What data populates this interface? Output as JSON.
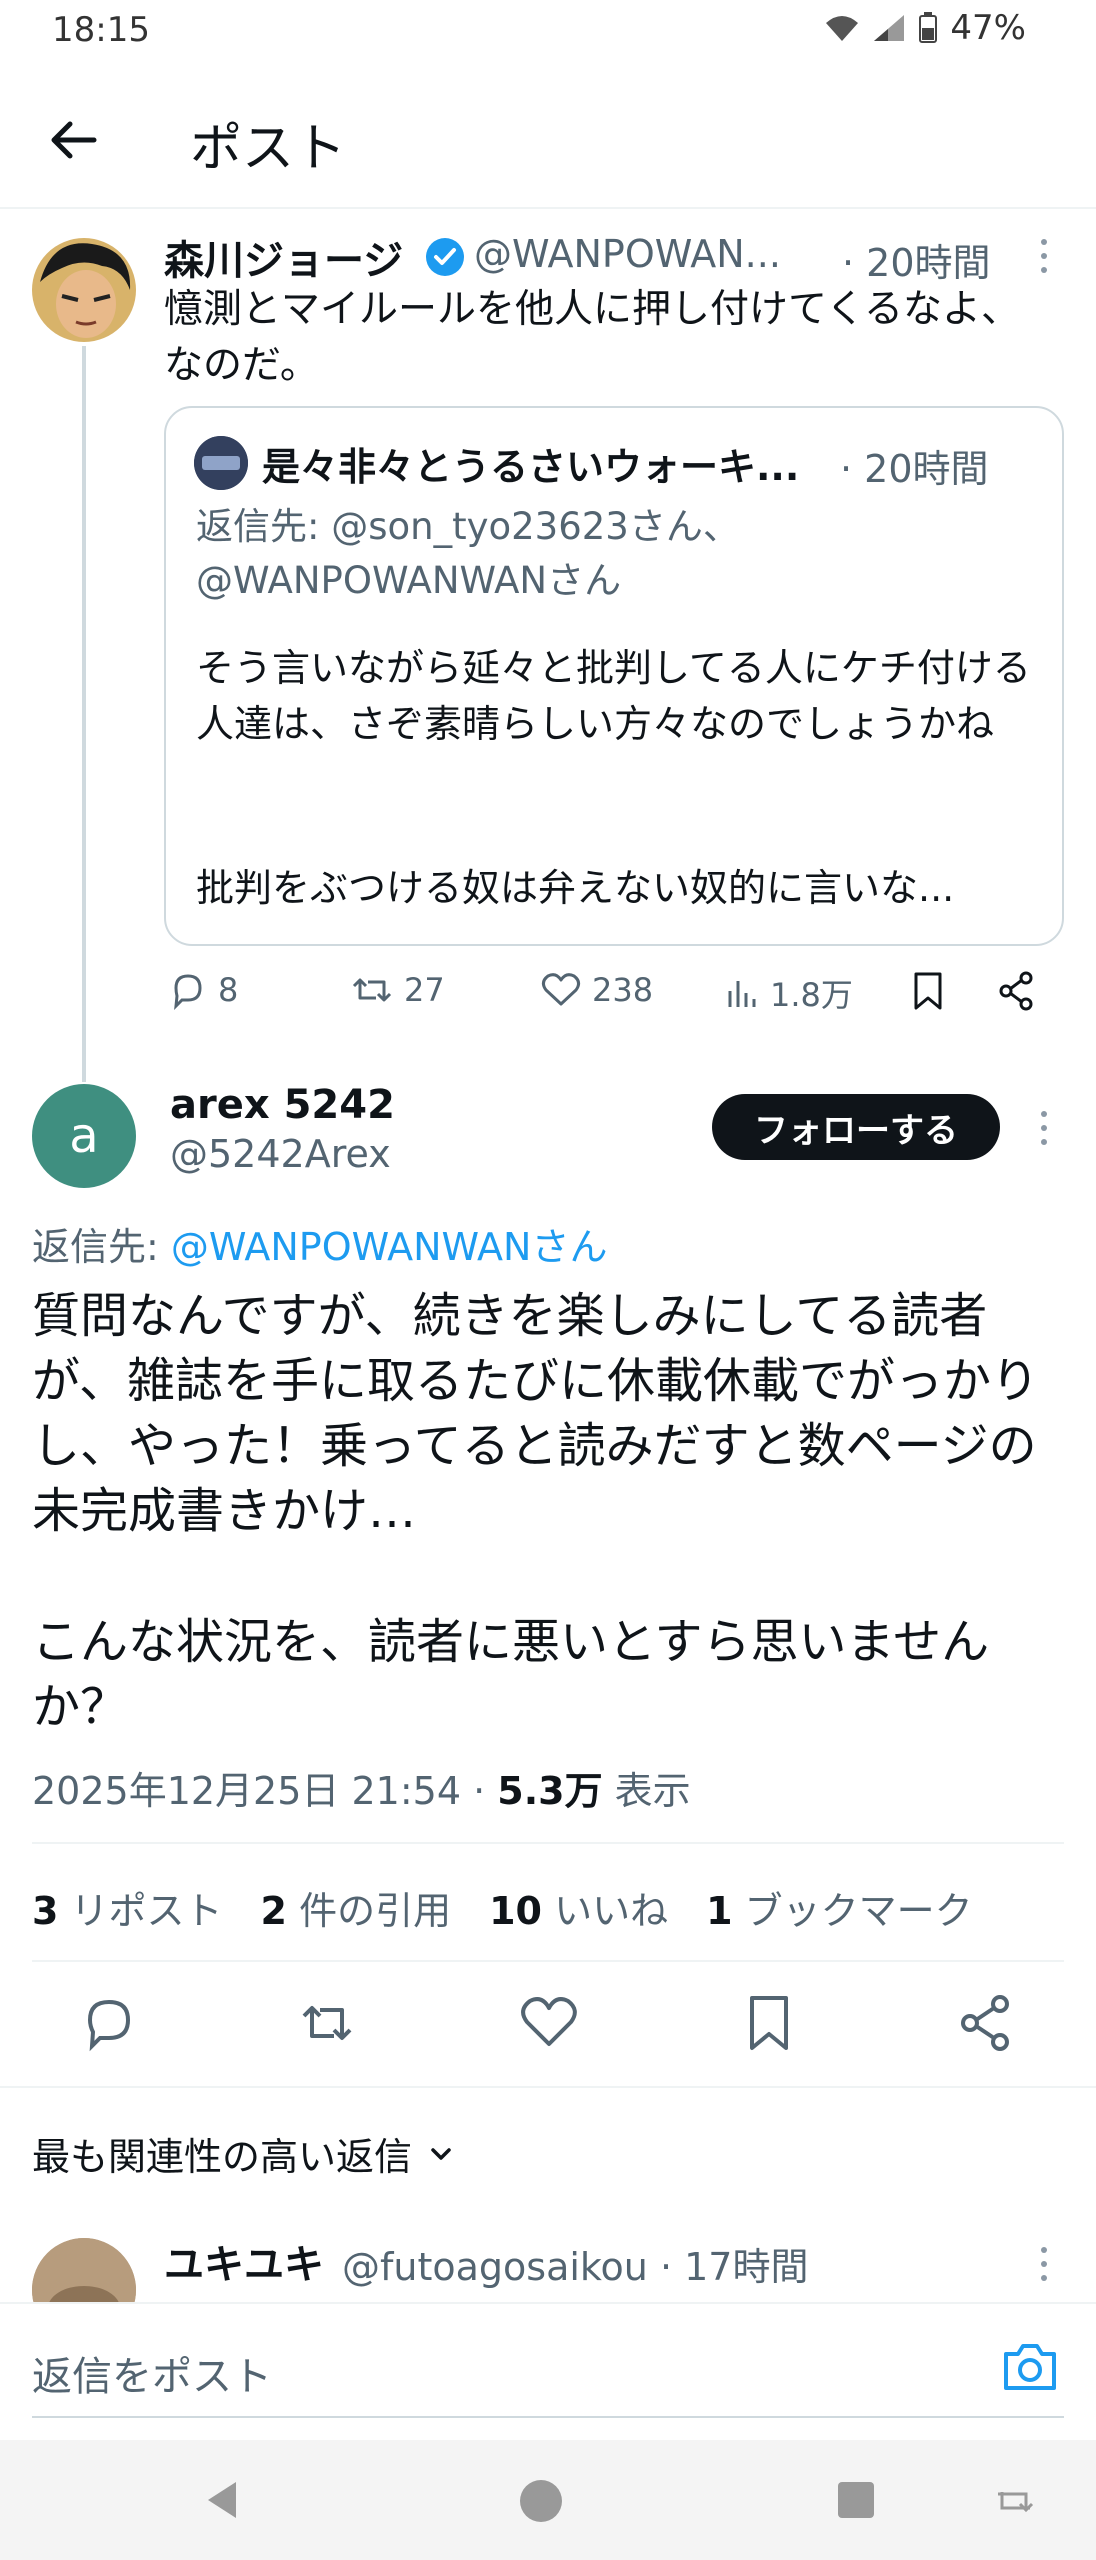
{
  "status_bar": {
    "time": "18:15",
    "battery": "47%"
  },
  "header": {
    "title": "ポスト"
  },
  "parent_tweet": {
    "author_name": "森川ジョージ",
    "handle": "@WANPOWAN...",
    "time": "· 20時間",
    "text": "憶測とマイルールを他人に押し付けてくるなよ、なのだ。",
    "quote": {
      "author_name": "是々非々とうるさいウォーキ...",
      "time": "· 20時間",
      "reply_line1": "返信先: @son_tyo23623さん、",
      "reply_line2": "@WANPOWANWANさん",
      "body": "そう言いながら延々と批判してる人にケチ付ける人達は、さぞ素晴らしい方々なのでしょうかね",
      "body2": "批判をぶつける奴は弁えない奴的に言いな..."
    },
    "actions": {
      "replies": "8",
      "reposts": "27",
      "likes": "238",
      "views": "1.8万"
    }
  },
  "main_tweet": {
    "avatar_letter": "a",
    "author_name": "arex 5242",
    "handle": "@5242Arex",
    "follow_label": "フォローする",
    "reply_prefix": "返信先: ",
    "reply_to": "@WANPOWANWANさん",
    "text": "質問なんですが、続きを楽しみにしてる読者が、雑誌を手に取るたびに休載休載でがっかりし、やった！乗ってると読みだすと数ページの未完成書きかけ…",
    "text2": "こんな状況を、読者に悪いとすら思いませんか？",
    "datetime": "2025年12月25日 21:54 · ",
    "views_count": "5.3万",
    "views_label": " 表示",
    "stats": [
      {
        "count": "3",
        "label": " リポスト"
      },
      {
        "count": "2",
        "label": " 件の引用"
      },
      {
        "count": "10",
        "label": " いいね"
      },
      {
        "count": "1",
        "label": " ブックマーク"
      }
    ]
  },
  "replies_section": {
    "sort_label": "最も関連性の高い返信"
  },
  "reply_preview": {
    "author_name": "ユキユキ",
    "handle": "@futoagosaikou · 17時間"
  },
  "compose": {
    "placeholder": "返信をポスト"
  },
  "colors": {
    "accent": "#1d9bf0",
    "muted": "#536471",
    "avatar_main": "#3f8f80"
  }
}
